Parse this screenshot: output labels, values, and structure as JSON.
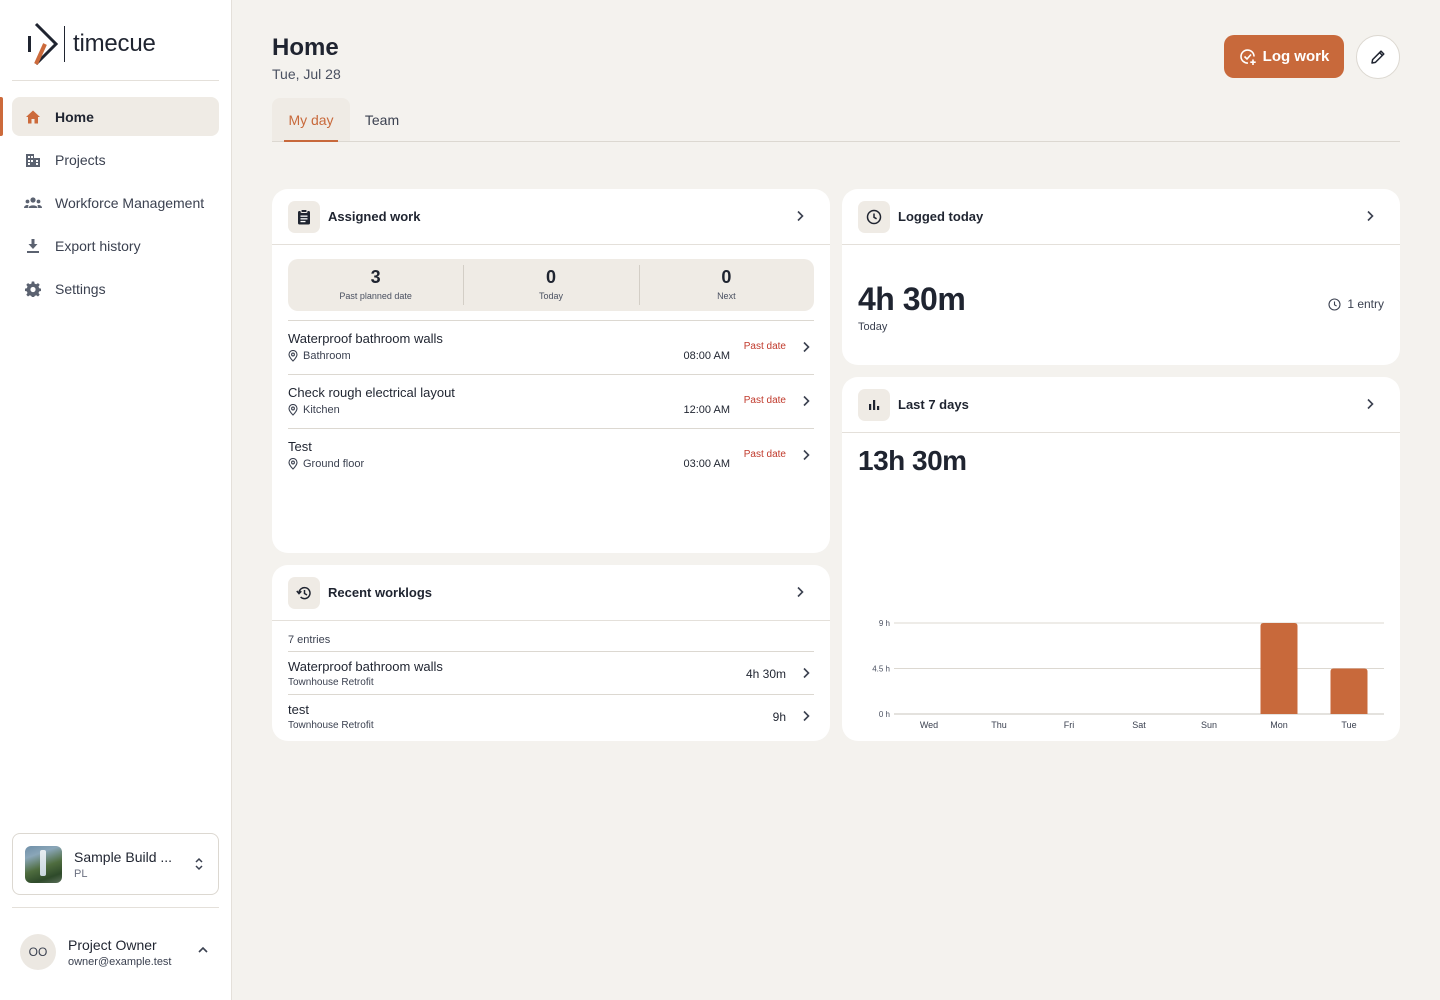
{
  "app": {
    "logo_text": "timecue"
  },
  "sidebar": {
    "items": [
      {
        "label": "Home",
        "icon": "home-icon"
      },
      {
        "label": "Projects",
        "icon": "building-icon"
      },
      {
        "label": "Workforce Management",
        "icon": "people-icon"
      },
      {
        "label": "Export history",
        "icon": "download-icon"
      },
      {
        "label": "Settings",
        "icon": "gear-icon"
      }
    ],
    "org": {
      "name": "Sample Build ...",
      "sub": "PL"
    },
    "user": {
      "initials": "OO",
      "name": "Project Owner",
      "email": "owner@example.test"
    }
  },
  "header": {
    "title": "Home",
    "date": "Tue, Jul 28",
    "log_button": "Log work"
  },
  "tabs": [
    {
      "label": "My day"
    },
    {
      "label": "Team"
    }
  ],
  "assigned": {
    "title": "Assigned work",
    "stats": [
      {
        "num": "3",
        "label": "Past planned date"
      },
      {
        "num": "0",
        "label": "Today"
      },
      {
        "num": "0",
        "label": "Next"
      }
    ],
    "tasks": [
      {
        "name": "Waterproof bathroom walls",
        "location": "Bathroom",
        "time": "08:00 AM",
        "badge": "Past date"
      },
      {
        "name": "Check rough electrical layout",
        "location": "Kitchen",
        "time": "12:00 AM",
        "badge": "Past date"
      },
      {
        "name": "Test",
        "location": "Ground floor",
        "time": "03:00 AM",
        "badge": "Past date"
      }
    ]
  },
  "recent": {
    "title": "Recent worklogs",
    "count": "7 entries",
    "items": [
      {
        "name": "Waterproof bathroom walls",
        "project": "Townhouse Retrofit",
        "duration": "4h 30m"
      },
      {
        "name": "test",
        "project": "Townhouse Retrofit",
        "duration": "9h"
      }
    ]
  },
  "logged": {
    "title": "Logged today",
    "value": "4h 30m",
    "sub": "Today",
    "entries": "1 entry"
  },
  "last7": {
    "title": "Last 7 days",
    "value": "13h 30m"
  },
  "colors": {
    "accent": "#c8693b",
    "danger": "#c0392b"
  },
  "chart_data": {
    "type": "bar",
    "categories": [
      "Wed",
      "Thu",
      "Fri",
      "Sat",
      "Sun",
      "Mon",
      "Tue"
    ],
    "values": [
      0,
      0,
      0,
      0,
      0,
      9,
      4.5
    ],
    "yticks": [
      "0 h",
      "4.5 h",
      "9 h"
    ],
    "ylim": [
      0,
      9
    ],
    "grid": true,
    "color": "#c8693b"
  }
}
